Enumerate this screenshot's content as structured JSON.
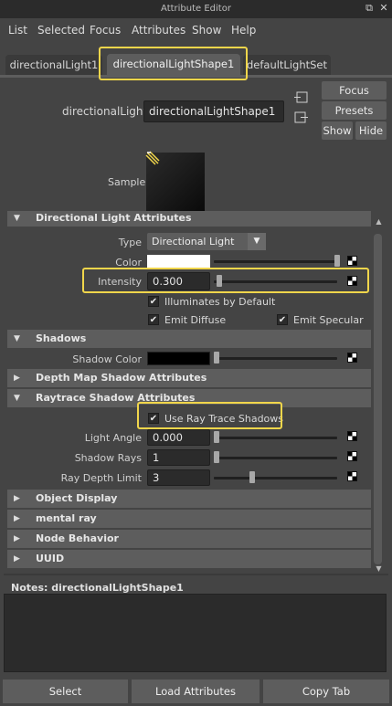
{
  "window": {
    "title": "Attribute Editor"
  },
  "menu": [
    "List",
    "Selected",
    "Focus",
    "Attributes",
    "Show",
    "Help"
  ],
  "tabs": [
    "directionalLight1",
    "directionalLightShape1",
    "defaultLightSet"
  ],
  "node": {
    "label": "directionalLight:",
    "value": "directionalLightShape1"
  },
  "side_buttons": {
    "focus": "Focus",
    "presets": "Presets",
    "show": "Show",
    "hide": "Hide"
  },
  "sample_label": "Sample",
  "sections": {
    "directional_light": "Directional Light Attributes",
    "shadows": "Shadows",
    "depth_map": "Depth Map Shadow Attributes",
    "raytrace": "Raytrace Shadow Attributes",
    "object_display": "Object Display",
    "mental_ray": "mental ray",
    "node_behavior": "Node Behavior",
    "uuid": "UUID"
  },
  "attrs": {
    "type_label": "Type",
    "type_value": "Directional Light",
    "color_label": "Color",
    "color_value": "#ffffff",
    "intensity_label": "Intensity",
    "intensity_value": "0.300",
    "illuminates": "Illuminates by Default",
    "emit_diffuse": "Emit Diffuse",
    "emit_specular": "Emit Specular",
    "shadow_color_label": "Shadow Color",
    "shadow_color_value": "#000000",
    "use_ray_trace": "Use Ray Trace Shadows",
    "light_angle_label": "Light Angle",
    "light_angle_value": "0.000",
    "shadow_rays_label": "Shadow Rays",
    "shadow_rays_value": "1",
    "ray_depth_label": "Ray Depth Limit",
    "ray_depth_value": "3"
  },
  "notes": {
    "label": "Notes:  directionalLightShape1"
  },
  "bottom_buttons": [
    "Select",
    "Load Attributes",
    "Copy Tab"
  ],
  "checkmark": "✔",
  "colors": {
    "highlight": "#f1d64b",
    "panel": "#444444",
    "header": "#5d5d5d",
    "field": "#2b2b2b"
  }
}
